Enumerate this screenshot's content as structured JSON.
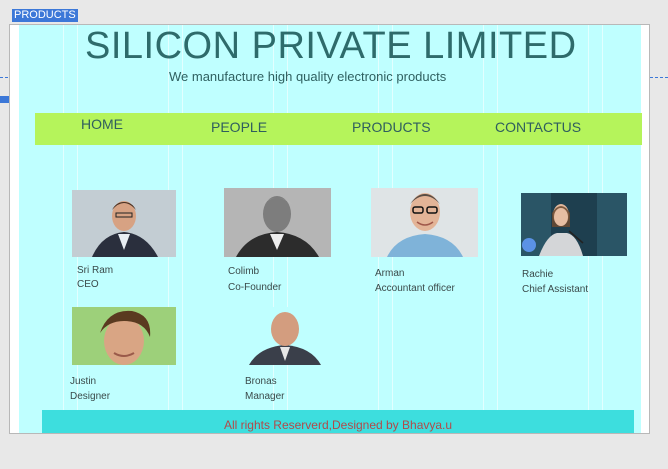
{
  "selection_tag": "PRODUCTS",
  "header": {
    "title": "SILICON PRIVATE LIMITED",
    "subtitle": "We manufacture high quality electronic products"
  },
  "nav": {
    "items": [
      "HOME",
      "PEOPLE",
      "PRODUCTS",
      "CONTACTUS"
    ]
  },
  "people": [
    {
      "name": "Sri Ram",
      "role": "CEO"
    },
    {
      "name": "Colimb",
      "role": "Co-Founder"
    },
    {
      "name": "Arman",
      "role": "Accountant officer"
    },
    {
      "name": "Rachie",
      "role": "Chief Assistant"
    },
    {
      "name": "Justin",
      "role": "Designer"
    },
    {
      "name": "Bronas",
      "role": "Manager"
    }
  ],
  "footer": {
    "text": "All rights Reserverd,Designed by Bhavya.u"
  },
  "colors": {
    "page_bg": "#bfffff",
    "nav_bg": "#b5f45b",
    "footer_bg": "#3ddede",
    "footer_text": "#b24a4a",
    "title_text": "#2e6b6b",
    "selection": "#3c78d8"
  }
}
